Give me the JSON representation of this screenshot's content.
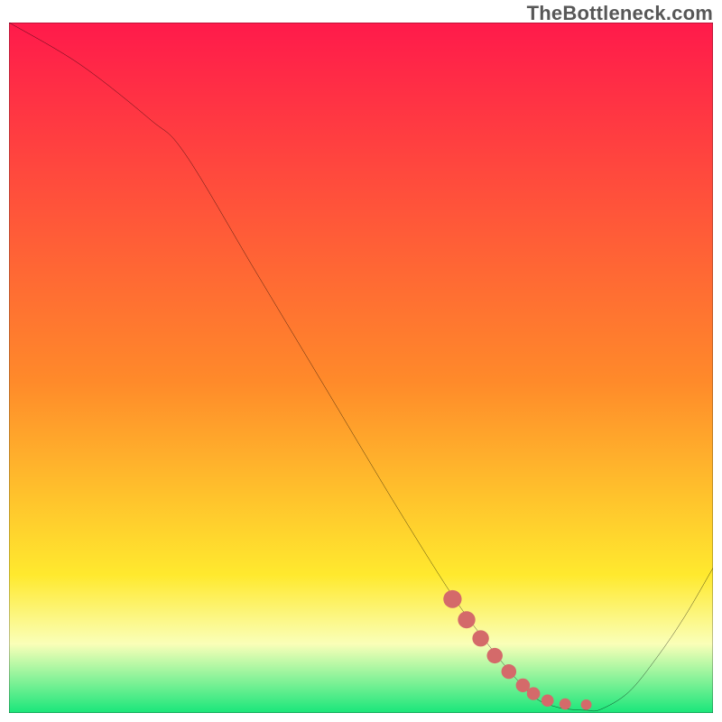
{
  "watermark": "TheBottleneck.com",
  "colors": {
    "top": "#ff1a4b",
    "mid1": "#ff8a2a",
    "mid2": "#ffe92e",
    "mid3": "#faffb8",
    "bottom": "#19e67a",
    "curve": "#000000",
    "marker": "#d46a6a",
    "frame": "#000000"
  },
  "chart_data": {
    "type": "line",
    "title": "",
    "xlabel": "",
    "ylabel": "",
    "xlim": [
      0,
      100
    ],
    "ylim": [
      0,
      100
    ],
    "series": [
      {
        "name": "bottleneck-curve",
        "x": [
          0,
          10,
          20,
          25,
          35,
          45,
          55,
          63,
          68,
          72,
          75,
          78,
          80,
          82,
          84,
          88,
          92,
          96,
          100
        ],
        "values": [
          100,
          94,
          86,
          81,
          64,
          47,
          30,
          17,
          10,
          5,
          2,
          0.8,
          0.5,
          0.4,
          0.5,
          3,
          8,
          14,
          21
        ]
      }
    ],
    "markers": {
      "name": "highlight-dots",
      "x": [
        63,
        65,
        67,
        69,
        71,
        73,
        74.5,
        76.5,
        79,
        82
      ],
      "values": [
        16.5,
        13.5,
        10.8,
        8.3,
        6.0,
        4.0,
        2.8,
        1.8,
        1.3,
        1.2
      ]
    },
    "gradient_stops_pct": [
      0,
      52,
      80,
      90,
      100
    ]
  }
}
